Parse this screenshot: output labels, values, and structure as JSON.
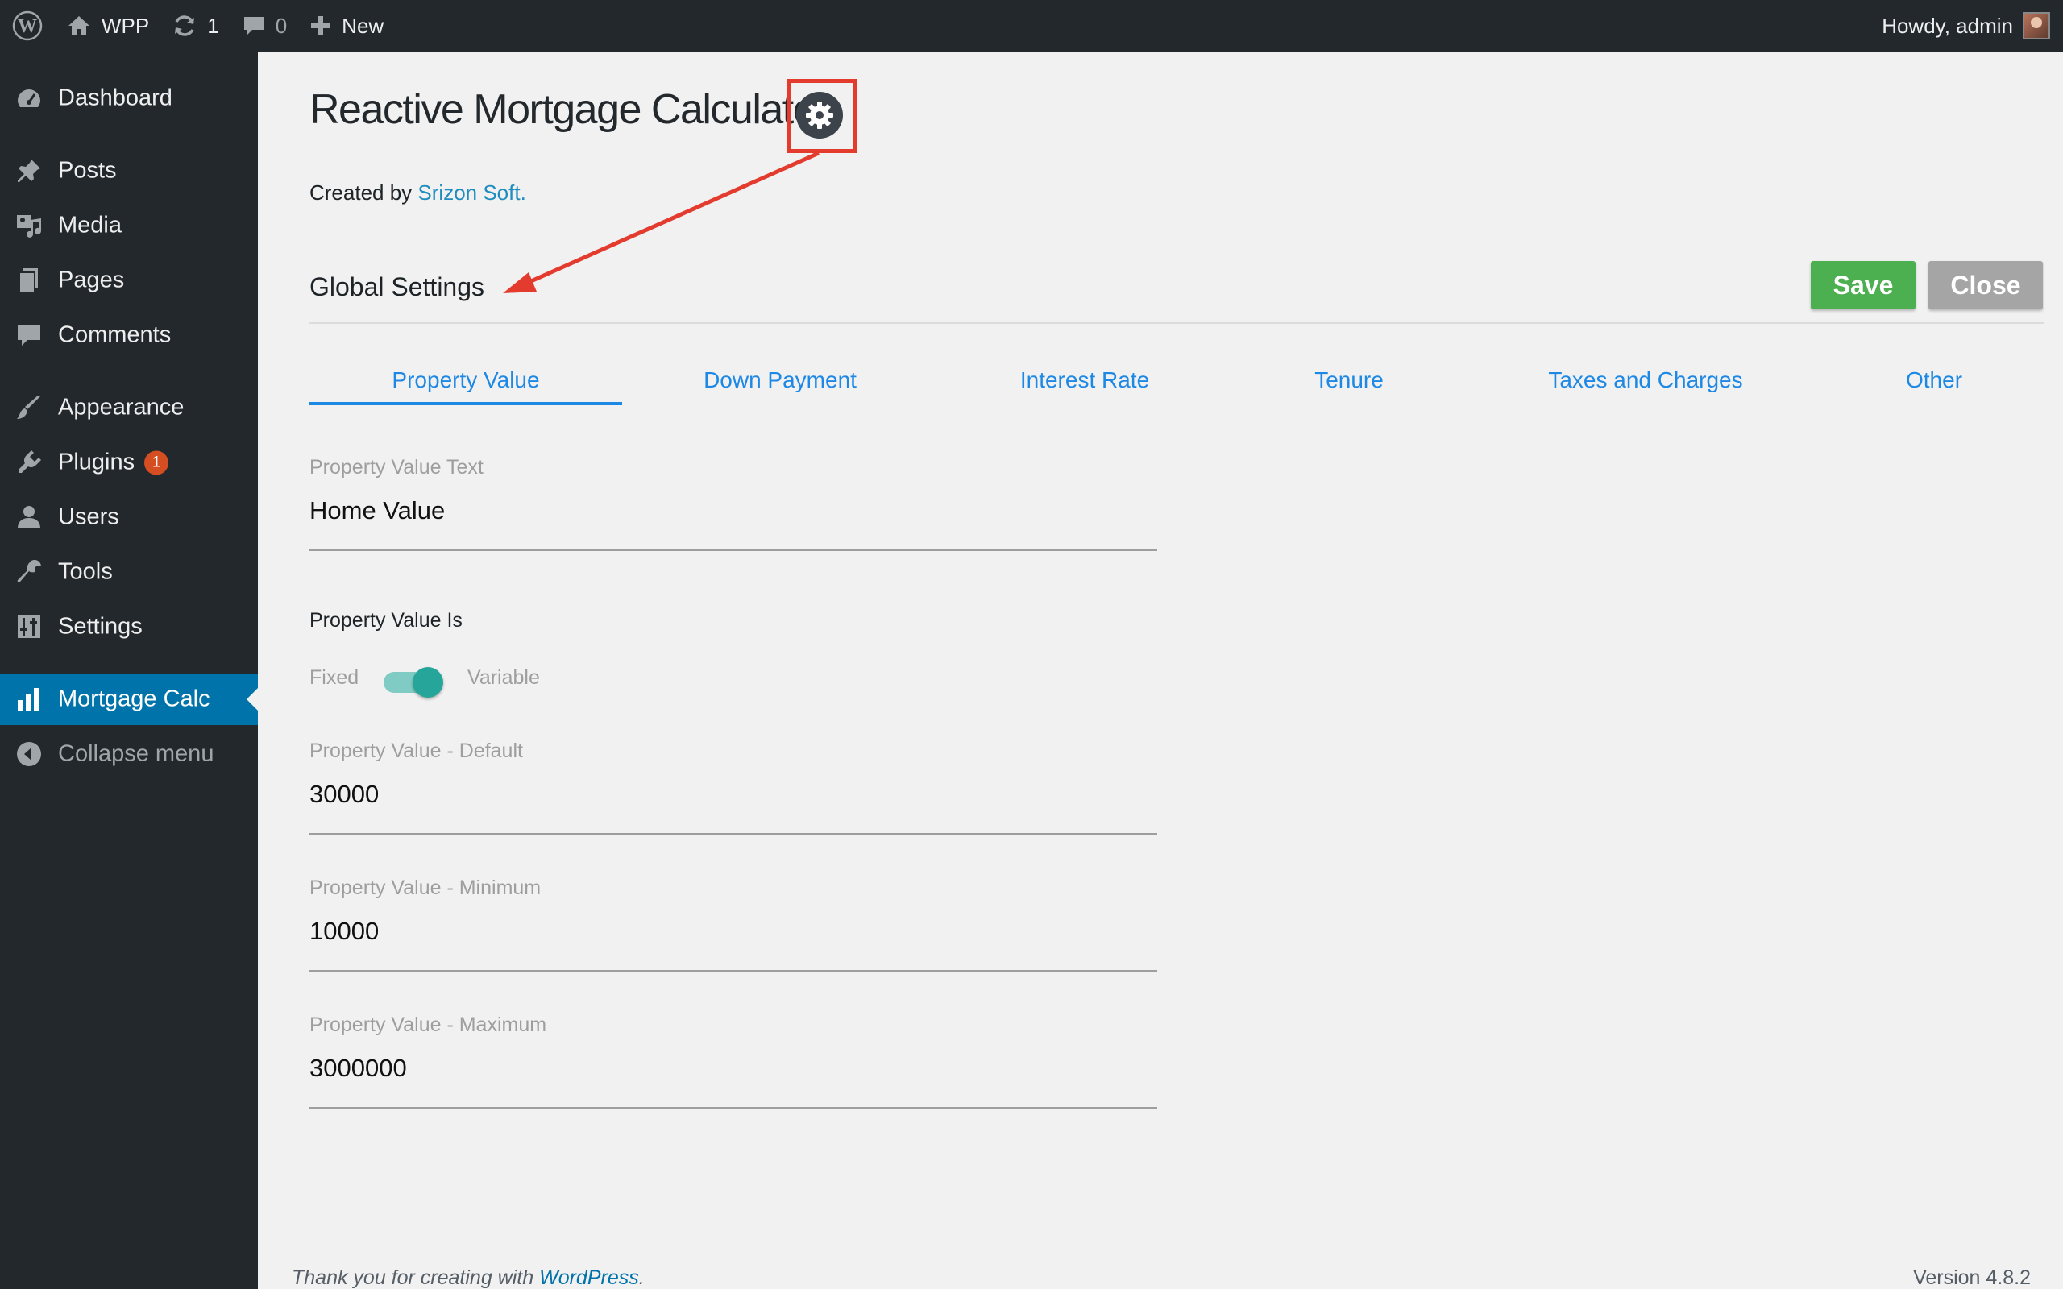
{
  "admin_bar": {
    "site_name": "WPP",
    "updates_count": "1",
    "comments_count": "0",
    "new_label": "New",
    "greeting": "Howdy, admin"
  },
  "sidebar": {
    "items": [
      {
        "label": "Dashboard",
        "icon": "dashboard-icon"
      },
      {
        "label": "Posts",
        "icon": "pin-icon"
      },
      {
        "label": "Media",
        "icon": "media-icon"
      },
      {
        "label": "Pages",
        "icon": "pages-icon"
      },
      {
        "label": "Comments",
        "icon": "comment-icon"
      },
      {
        "label": "Appearance",
        "icon": "brush-icon"
      },
      {
        "label": "Plugins",
        "icon": "plugin-icon",
        "badge": "1"
      },
      {
        "label": "Users",
        "icon": "users-icon"
      },
      {
        "label": "Tools",
        "icon": "wrench-icon"
      },
      {
        "label": "Settings",
        "icon": "sliders-icon"
      },
      {
        "label": "Mortgage Calc",
        "icon": "chart-icon",
        "active": true
      },
      {
        "label": "Collapse menu",
        "icon": "collapse-icon"
      }
    ]
  },
  "header": {
    "title": "Reactive Mortgage Calculator",
    "created_by_prefix": "Created by",
    "created_by_link": "Srizon Soft."
  },
  "settings": {
    "heading": "Global Settings",
    "save_label": "Save",
    "close_label": "Close"
  },
  "tabs": [
    {
      "label": "Property Value",
      "active": true
    },
    {
      "label": "Down Payment"
    },
    {
      "label": "Interest Rate"
    },
    {
      "label": "Tenure"
    },
    {
      "label": "Taxes and Charges"
    },
    {
      "label": "Other"
    }
  ],
  "form": {
    "text_field": {
      "label": "Property Value Text",
      "value": "Home Value"
    },
    "is_label": "Property Value Is",
    "toggle": {
      "off_label": "Fixed",
      "on_label": "Variable",
      "state": "Variable"
    },
    "default_field": {
      "label": "Property Value - Default",
      "value": "30000"
    },
    "minimum_field": {
      "label": "Property Value - Minimum",
      "value": "10000"
    },
    "maximum_field": {
      "label": "Property Value - Maximum",
      "value": "3000000"
    }
  },
  "footer": {
    "thanks_prefix": "Thank you for creating with",
    "thanks_link": "WordPress",
    "thanks_suffix": ".",
    "version": "Version 4.8.2"
  },
  "colors": {
    "admin_bar_bg": "#23282d",
    "active_menu": "#0073aa",
    "tab_blue": "#1e88e5",
    "save_green": "#4caf50",
    "close_gray": "#a5a5a5",
    "toggle_teal": "#26a69a",
    "annotation_red": "#e33b2e"
  }
}
